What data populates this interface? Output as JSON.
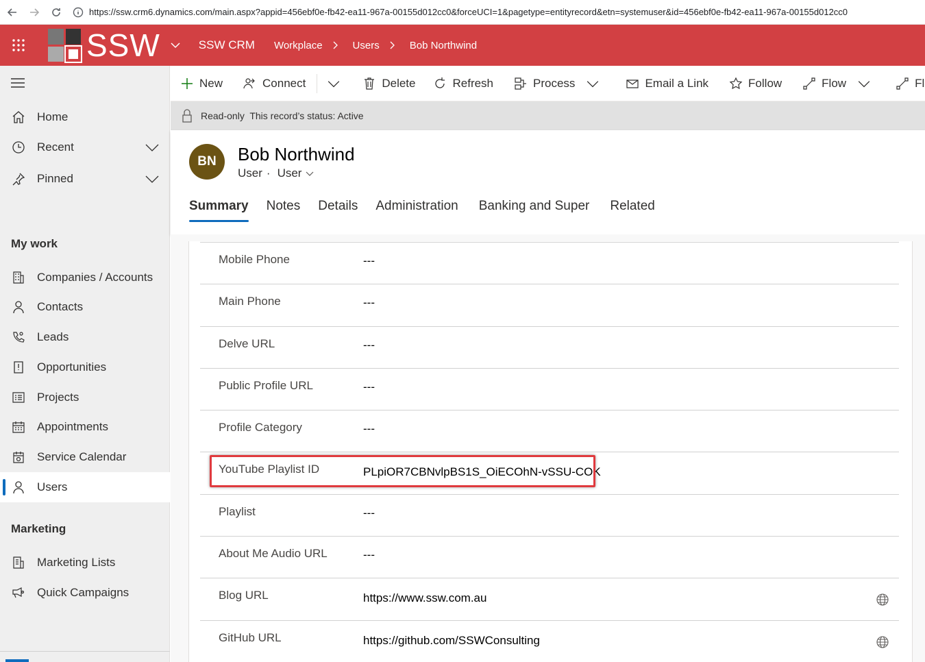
{
  "browser": {
    "url": "https://ssw.crm6.dynamics.com/main.aspx?appid=456ebf0e-fb42-ea11-967a-00155d012cc0&forceUCI=1&pagetype=entityrecord&etn=systemuser&id=456ebf0e-fb42-ea11-967a-00155d012cc0"
  },
  "header": {
    "logo_text": "SSW",
    "app_name": "SSW CRM",
    "breadcrumbs": [
      "Workplace",
      "Users",
      "Bob Northwind"
    ],
    "brand_color": "#d24043"
  },
  "sidebar": {
    "top_items": [
      {
        "label": "Home",
        "icon": "home-icon"
      },
      {
        "label": "Recent",
        "icon": "clock-icon"
      },
      {
        "label": "Pinned",
        "icon": "pin-icon"
      }
    ],
    "groups": [
      {
        "title": "My work",
        "items": [
          {
            "label": "Companies / Accounts",
            "icon": "building-icon"
          },
          {
            "label": "Contacts",
            "icon": "person-icon"
          },
          {
            "label": "Leads",
            "icon": "phone-person-icon"
          },
          {
            "label": "Opportunities",
            "icon": "clipboard-icon"
          },
          {
            "label": "Projects",
            "icon": "list-icon"
          },
          {
            "label": "Appointments",
            "icon": "calendar-icon"
          },
          {
            "label": "Service Calendar",
            "icon": "service-calendar-icon"
          },
          {
            "label": "Users",
            "icon": "person-icon",
            "active": true
          }
        ]
      },
      {
        "title": "Marketing",
        "items": [
          {
            "label": "Marketing Lists",
            "icon": "marketing-list-icon"
          },
          {
            "label": "Quick Campaigns",
            "icon": "campaign-icon"
          }
        ]
      }
    ]
  },
  "commands": [
    "New",
    "Connect",
    "Delete",
    "Refresh",
    "Process",
    "Email a Link",
    "Follow",
    "Flow",
    "Flo"
  ],
  "readonly_notice": "Read-only  This record’s status: Active",
  "record": {
    "initials": "BN",
    "avatar_color": "#6b5314",
    "name": "Bob Northwind",
    "entity": "User",
    "form_selector": "User",
    "tabs": [
      "Summary",
      "Notes",
      "Details",
      "Administration",
      "Banking and Super",
      "Related"
    ],
    "active_tab": "Summary"
  },
  "fields": [
    {
      "label": "Mobile Phone",
      "value": "---"
    },
    {
      "label": "Main Phone",
      "value": "---"
    },
    {
      "label": "Delve URL",
      "value": "---"
    },
    {
      "label": "Public Profile URL",
      "value": "---"
    },
    {
      "label": "Profile Category",
      "value": "---"
    },
    {
      "label": "YouTube Playlist ID",
      "value": "PLpiOR7CBNvlpBS1S_OiECOhN-vSSU-COK",
      "highlighted": true
    },
    {
      "label": "Playlist",
      "value": "---"
    },
    {
      "label": "About Me Audio URL",
      "value": "---"
    },
    {
      "label": "Blog URL",
      "value": "https://www.ssw.com.au",
      "icon": "globe-icon"
    },
    {
      "label": "GitHub URL",
      "value": "https://github.com/SSWConsulting",
      "icon": "globe-icon"
    }
  ]
}
